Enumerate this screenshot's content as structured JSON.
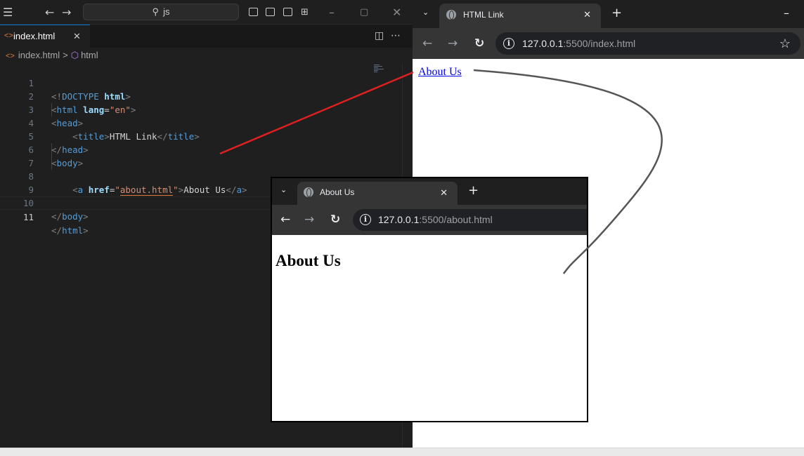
{
  "vscode": {
    "search_text": "js",
    "tab": {
      "label": "index.html",
      "close": "✕"
    },
    "breadcrumb": {
      "file": "index.html",
      "separator": ">",
      "symbol": "html"
    },
    "lines": [
      {
        "num": "1"
      },
      {
        "num": "2"
      },
      {
        "num": "3"
      },
      {
        "num": "4"
      },
      {
        "num": "5"
      },
      {
        "num": "6"
      },
      {
        "num": "7"
      },
      {
        "num": "8"
      },
      {
        "num": "9"
      },
      {
        "num": "10"
      },
      {
        "num": "11"
      }
    ],
    "code": {
      "doctype": "DOCTYPE",
      "doctype_kw": "html",
      "html_tag": "html",
      "lang_attr": "lang",
      "lang_val": "\"en\"",
      "head_tag": "head",
      "title_tag": "title",
      "title_text": "HTML Link",
      "body_tag": "body",
      "a_tag": "a",
      "href_attr": "href",
      "href_val": "about.html",
      "link_text": "About Us"
    },
    "theme": {
      "background": "#1f1f1f",
      "accent": "#0078d4",
      "tag_color": "#569cd6",
      "string_color": "#ce9178",
      "attr_color": "#9cdcfe"
    }
  },
  "chrome_main": {
    "tab_title": "HTML Link",
    "tab_close": "✕",
    "new_tab": "+",
    "minimize": "–",
    "url_host": "127.0.0.1",
    "url_path": ":5500/index.html",
    "link_text": "About Us",
    "link_color": "#0000ee"
  },
  "chrome_about": {
    "tab_title": "About Us",
    "tab_close": "✕",
    "new_tab": "+",
    "url_host": "127.0.0.1",
    "url_path": ":5500/about.html",
    "heading": "About Us"
  },
  "annotations": {
    "red_line_color": "#e02020",
    "gray_curve_color": "#555555"
  },
  "icons": [
    "menu-icon",
    "back-arrow-icon",
    "forward-arrow-icon",
    "search-icon",
    "layout-icon",
    "split-editor-icon",
    "more-icon",
    "html-file-icon",
    "symbol-icon",
    "dropdown-chevron-icon",
    "globe-icon",
    "reload-icon",
    "info-icon",
    "star-icon"
  ]
}
